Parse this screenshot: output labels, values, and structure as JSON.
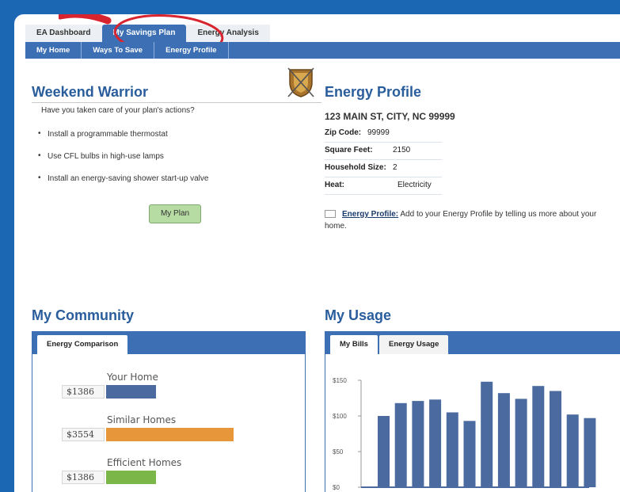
{
  "tabs": {
    "items": [
      "EA Dashboard",
      "My Savings Plan",
      "Energy Analysis"
    ],
    "active": 1
  },
  "subnav": {
    "items": [
      "My Home",
      "Ways To Save",
      "Energy Profile"
    ]
  },
  "weekend_warrior": {
    "title": "Weekend Warrior",
    "question": "Have you taken care of your plan's actions?",
    "actions": [
      "Install a programmable thermostat",
      "Use CFL bulbs in high-use lamps",
      "Install an energy-saving shower start-up valve"
    ],
    "button": "My Plan"
  },
  "energy_profile": {
    "title": "Energy Profile",
    "address": "123 MAIN ST, CITY, NC 99999",
    "rows": [
      {
        "label": "Zip Code:",
        "value": "99999"
      },
      {
        "label": "Square Feet:",
        "value": "2150"
      },
      {
        "label": "Household Size:",
        "value": "2"
      },
      {
        "label": "Heat:",
        "value": "Electricity"
      }
    ],
    "link_label": "Energy Profile:",
    "link_text": " Add to your Energy Profile by telling us more about your home."
  },
  "community": {
    "title": "My Community",
    "tab": "Energy Comparison",
    "items": [
      {
        "label": "Your Home",
        "value": "$1386",
        "color": "#4a6aa0",
        "fraction": 0.39
      },
      {
        "label": "Similar Homes",
        "value": "$3554",
        "color": "#e8963a",
        "fraction": 1.0
      },
      {
        "label": "Efficient Homes",
        "value": "$1386",
        "color": "#7ab648",
        "fraction": 0.39
      }
    ]
  },
  "usage": {
    "title": "My Usage",
    "tabs": [
      "My Bills",
      "Energy Usage"
    ],
    "active_tab": 0
  },
  "chart_data": {
    "type": "bar",
    "yticks": [
      "$150",
      "$100",
      "$50",
      "$0"
    ],
    "ylim": [
      0,
      150
    ],
    "values": [
      100,
      118,
      121,
      123,
      105,
      93,
      148,
      132,
      124,
      142,
      135,
      102,
      97
    ],
    "bar_color": "#4a6aa0"
  }
}
